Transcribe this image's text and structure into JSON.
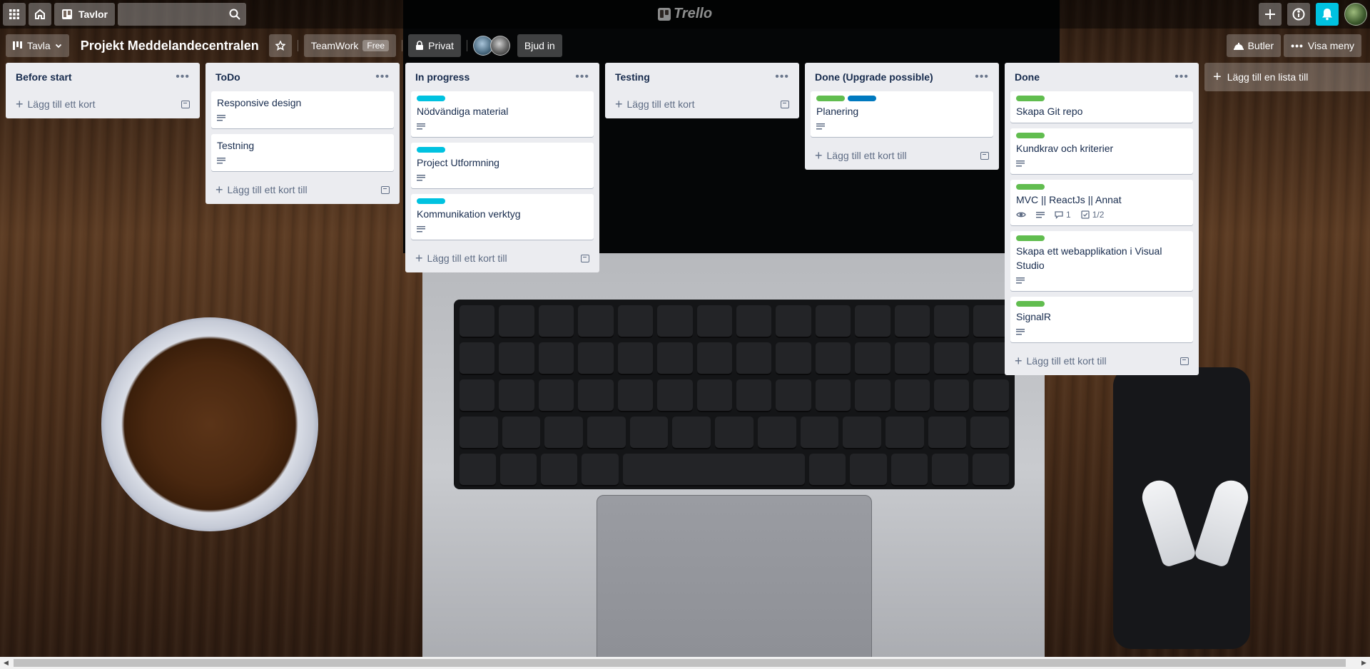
{
  "app": {
    "logo_text": "Trello",
    "boards_label": "Tavlor",
    "search_placeholder": ""
  },
  "board": {
    "view_label": "Tavla",
    "title": "Projekt Meddelandecentralen",
    "workspace_label": "TeamWork",
    "workspace_badge": "Free",
    "visibility_label": "Privat",
    "invite_label": "Bjud in",
    "butler_label": "Butler",
    "menu_label": "Visa meny",
    "add_list_label": "Lägg till en lista till"
  },
  "colors": {
    "green_label": "#61bd4f",
    "sky_label": "#00c2e0",
    "blue_label": "#0079bf",
    "notification": "#00c2e0"
  },
  "lists": [
    {
      "title": "Before start",
      "add_label": "Lägg till ett kort",
      "cards": []
    },
    {
      "title": "ToDo",
      "add_label": "Lägg till ett kort till",
      "cards": [
        {
          "title": "Responsive design",
          "labels": [],
          "description": true
        },
        {
          "title": "Testning",
          "labels": [],
          "description": true
        }
      ]
    },
    {
      "title": "In progress",
      "add_label": "Lägg till ett kort till",
      "cards": [
        {
          "title": "Nödvändiga material",
          "labels": [
            "sky"
          ],
          "description": true
        },
        {
          "title": "Project Utformning",
          "labels": [
            "sky"
          ],
          "description": true
        },
        {
          "title": "Kommunikation verktyg",
          "labels": [
            "sky"
          ],
          "description": true
        }
      ]
    },
    {
      "title": "Testing",
      "add_label": "Lägg till ett kort",
      "cards": []
    },
    {
      "title": "Done (Upgrade possible)",
      "add_label": "Lägg till ett kort till",
      "cards": [
        {
          "title": "Planering",
          "labels": [
            "green",
            "blue"
          ],
          "description": true
        }
      ]
    },
    {
      "title": "Done",
      "add_label": "Lägg till ett kort till",
      "cards": [
        {
          "title": "Skapa Git repo",
          "labels": [
            "green"
          ],
          "description": false
        },
        {
          "title": "Kundkrav och kriterier",
          "labels": [
            "green"
          ],
          "description": true
        },
        {
          "title": "MVC || ReactJs || Annat",
          "labels": [
            "green"
          ],
          "description": true,
          "watching": true,
          "comments": "1",
          "checklist": "1/2"
        },
        {
          "title": "Skapa ett webapplikation i Visual Studio",
          "labels": [
            "green"
          ],
          "description": true
        },
        {
          "title": "SignalR",
          "labels": [
            "green"
          ],
          "description": true
        }
      ]
    }
  ]
}
